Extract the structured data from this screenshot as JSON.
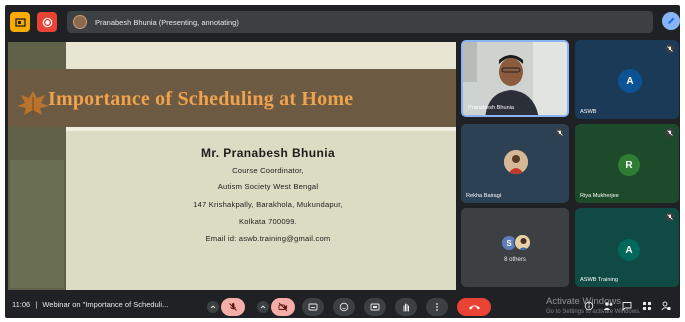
{
  "topbar": {
    "presenting_text": "Pranabesh Bhunia (Presenting, annotating)"
  },
  "slide": {
    "title": "Importance of Scheduling at Home",
    "name": "Mr. Pranabesh Bhunia",
    "lines": [
      "Course Coordinator,",
      "Autism Society West Bengal",
      "147 Krishakpally, Barakhola, Mukundapur,",
      "Kolkata 700099.",
      "Email id: aswb.training@gmail.com"
    ]
  },
  "participants": [
    {
      "name": "Pranabesh Bhunia"
    },
    {
      "name": "ASWB",
      "initial": "A"
    },
    {
      "name": "Rekha Bairagi"
    },
    {
      "name": "Riya Mukherjee",
      "initial": "R"
    },
    {
      "name": "8 others",
      "initial": "S"
    },
    {
      "name": "ASWB Training",
      "initial": "A"
    }
  ],
  "bottombar": {
    "time": "11:06",
    "separator": "|",
    "meeting_title": "Webinar on \"Importance of Scheduli..."
  },
  "watermark": {
    "title": "Activate Windows",
    "subtitle": "Go to Settings to activate Windows."
  },
  "colors": {
    "end_call": "#ea4335",
    "accent": "#8ab4f8",
    "tile_bg_1": "#1b3a57",
    "tile_bg_2": "#1e4a2c",
    "tile_bg_3": "#0f4a45"
  }
}
